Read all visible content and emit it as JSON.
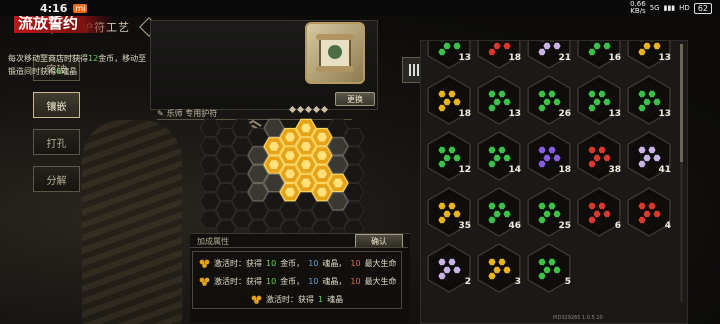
{
  "status_bar": {
    "time": "4:16",
    "carrier_badge": "mi",
    "network_speed": "0.66",
    "network_unit": "KB/s",
    "network_type": "5G",
    "signal_text": "HD",
    "battery": "62"
  },
  "header": {
    "title": "护符工艺"
  },
  "menu": [
    {
      "label": "突破",
      "active": false
    },
    {
      "label": "镶嵌",
      "active": true
    },
    {
      "label": "打孔",
      "active": false
    },
    {
      "label": "分解",
      "active": false
    }
  ],
  "amulet": {
    "name": "流放誓约",
    "desc_line1_prefix": "每次移动至商店时获得",
    "desc_line1_value": "12",
    "desc_line1_suffix": "金币，移动至",
    "desc_line2_prefix": "锻造间时获得",
    "desc_line2_value": "6",
    "desc_line2_suffix": "魂晶",
    "replace_label": "更换",
    "owner_label": "乐师 专用护符"
  },
  "socket_board": {
    "columns": [
      {
        "filled": [
          false,
          false,
          false
        ]
      },
      {
        "filled": [
          false,
          true,
          true,
          false
        ]
      },
      {
        "filled": [
          true,
          true,
          true,
          true
        ]
      },
      {
        "filled": [
          true,
          true,
          true,
          true
        ]
      },
      {
        "filled": [
          true,
          true,
          true,
          true
        ]
      },
      {
        "filled": [
          false,
          false,
          true,
          false
        ]
      }
    ]
  },
  "attributes": {
    "title": "加成属性",
    "confirm_label": "确认",
    "items": [
      {
        "prefix": "激活时：获得",
        "v1": "10",
        "u1": "金币，",
        "v2": "10",
        "u2": "魂晶，",
        "v3": "10",
        "u3": "最大生命"
      },
      {
        "prefix": "激活时：获得",
        "v1": "10",
        "u1": "金币，",
        "v2": "10",
        "u2": "魂晶，",
        "v3": "10",
        "u3": "最大生命"
      },
      {
        "prefix": "激活时：获得",
        "v1": "1",
        "u1": "魂晶",
        "v2": "",
        "u2": "",
        "v3": "",
        "u3": ""
      }
    ]
  },
  "inventory": {
    "gems": [
      {
        "color": "#3cc04a",
        "count": "13"
      },
      {
        "color": "#d63a2c",
        "count": "18"
      },
      {
        "color": "#c9b4e8",
        "count": "21"
      },
      {
        "color": "#3cc04a",
        "count": "16"
      },
      {
        "color": "#e8b520",
        "count": "13"
      },
      {
        "color": "#e8b520",
        "count": "18"
      },
      {
        "color": "#3cc04a",
        "count": "13"
      },
      {
        "color": "#3cc04a",
        "count": "26"
      },
      {
        "color": "#3cc04a",
        "count": "13"
      },
      {
        "color": "#3cc04a",
        "count": "13"
      },
      {
        "color": "#3cc04a",
        "count": "12"
      },
      {
        "color": "#3cc04a",
        "count": "14"
      },
      {
        "color": "#8a5ce0",
        "count": "18"
      },
      {
        "color": "#d63a2c",
        "count": "38"
      },
      {
        "color": "#c9b4e8",
        "count": "41"
      },
      {
        "color": "#e8b520",
        "count": "35"
      },
      {
        "color": "#3cc04a",
        "count": "46"
      },
      {
        "color": "#3cc04a",
        "count": "25"
      },
      {
        "color": "#d63a2c",
        "count": "6"
      },
      {
        "color": "#d63a2c",
        "count": "4"
      },
      {
        "color": "#c9b4e8",
        "count": "2"
      },
      {
        "color": "#e8b520",
        "count": "3"
      },
      {
        "color": "#3cc04a",
        "count": "5"
      }
    ]
  },
  "footer": {
    "pid": "PID329265 1.0.5.10"
  },
  "colors": {
    "accent_red": "#b51818",
    "value_green": "#6cd35a",
    "value_blue": "#5ba4e0",
    "gold": "#e8b520"
  }
}
